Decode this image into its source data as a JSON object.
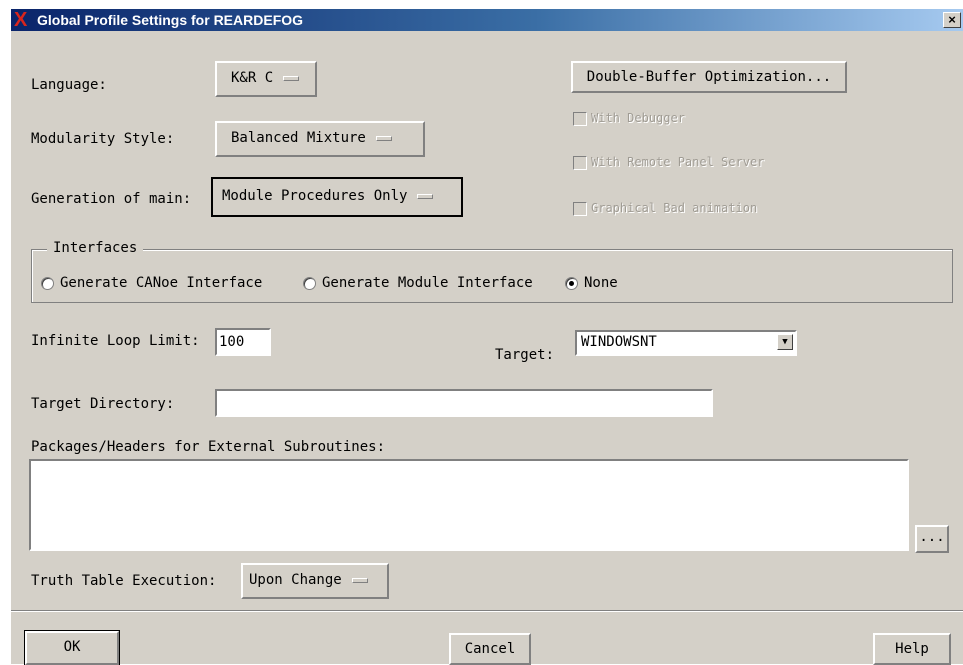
{
  "window": {
    "title": "Global Profile Settings for REARDEFOG",
    "close_glyph": "×",
    "app_icon": "x-logo-icon"
  },
  "language": {
    "label": "Language:",
    "value": "K&R C"
  },
  "modularity": {
    "label": "Modularity Style:",
    "value": "Balanced Mixture"
  },
  "generation_main": {
    "label": "Generation of main:",
    "value": "Module Procedures Only"
  },
  "double_buffer": {
    "label": "Double-Buffer Optimization..."
  },
  "checkboxes": {
    "with_debugger": "With Debugger",
    "with_remote_panel": "With Remote Panel Server",
    "graphical_animation": "Graphical Bad animation"
  },
  "interfaces": {
    "title": "Interfaces",
    "options": [
      "Generate CANoe Interface",
      "Generate Module Interface",
      "None"
    ],
    "selected": "None"
  },
  "loop_limit": {
    "label": "Infinite Loop Limit:",
    "value": "100"
  },
  "target": {
    "label": "Target:",
    "value": "WINDOWSNT"
  },
  "target_directory": {
    "label": "Target Directory:",
    "value": ""
  },
  "packages": {
    "label": "Packages/Headers for External Subroutines:",
    "value": "",
    "browse_label": "..."
  },
  "truth_table": {
    "label": "Truth Table Execution:",
    "value": "Upon Change"
  },
  "buttons": {
    "ok": "OK",
    "cancel": "Cancel",
    "help": "Help"
  }
}
